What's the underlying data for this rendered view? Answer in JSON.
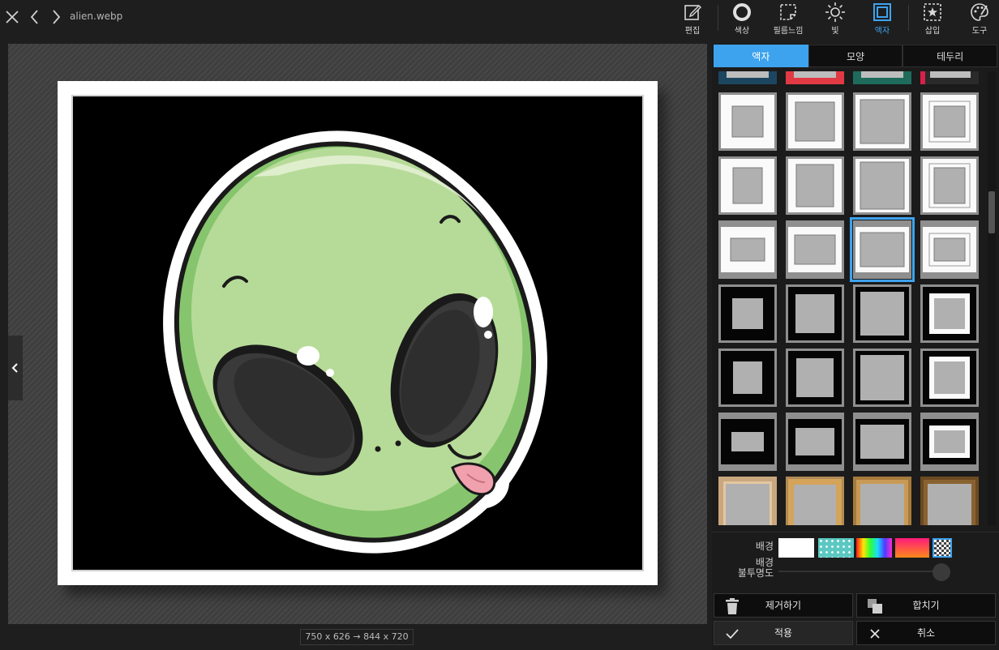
{
  "header": {
    "filename": "alien.webp",
    "tools": [
      {
        "label": "편집",
        "icon": "edit-icon"
      },
      {
        "label": "색상",
        "icon": "color-circle-icon"
      },
      {
        "label": "필름느낌",
        "icon": "film-icon"
      },
      {
        "label": "빛",
        "icon": "sun-icon"
      },
      {
        "label": "액자",
        "icon": "frame-icon"
      },
      {
        "label": "삽입",
        "icon": "insert-star-icon"
      },
      {
        "label": "도구",
        "icon": "palette-icon"
      }
    ],
    "active_tool": "액자"
  },
  "canvas": {
    "size_label": "750 x 626 → 844 x 720"
  },
  "panel": {
    "tabs": [
      "액자",
      "모양",
      "테두리"
    ],
    "active_tab": "액자",
    "background_label": "배경",
    "opacity_label_line1": "배경",
    "opacity_label_line2": "불투명도",
    "swatch_colors": [
      "#ffffff",
      "#5bc8c2",
      "rainbow",
      "#ff2a6d",
      "checker"
    ],
    "buttons": {
      "remove": "제거하기",
      "merge": "합치기",
      "apply": "적용",
      "cancel": "취소"
    }
  },
  "colors": {
    "accent": "#3ea3ee",
    "alien_skin": "#b6db98",
    "tongue": "#f0a1ad"
  }
}
